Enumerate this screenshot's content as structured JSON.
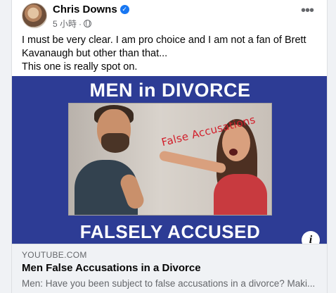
{
  "post": {
    "author": "Chris Downs",
    "timestamp": "5 小時",
    "text_lines": [
      "I must be very clear. I am pro choice and I am not a fan of Brett Kavanaugh but other than that...",
      "This one is really spot on."
    ]
  },
  "media": {
    "heading_top": "MEN in DIVORCE",
    "heading_bottom": "FALSELY ACCUSED",
    "overlay_text": "False Accusations",
    "info_label": "i"
  },
  "link_preview": {
    "domain": "YOUTUBE.COM",
    "title": "Men False Accusations in a Divorce",
    "description": "Men: Have you been subject to false accusations in a divorce? Maki..."
  },
  "icons": {
    "verified": "verified-badge-icon",
    "privacy": "globe-icon",
    "more": "more-options-icon",
    "info": "info-icon"
  },
  "colors": {
    "verified_blue": "#1877f2",
    "media_bg": "#2d3c95",
    "accusation_red": "#d21f2b"
  }
}
